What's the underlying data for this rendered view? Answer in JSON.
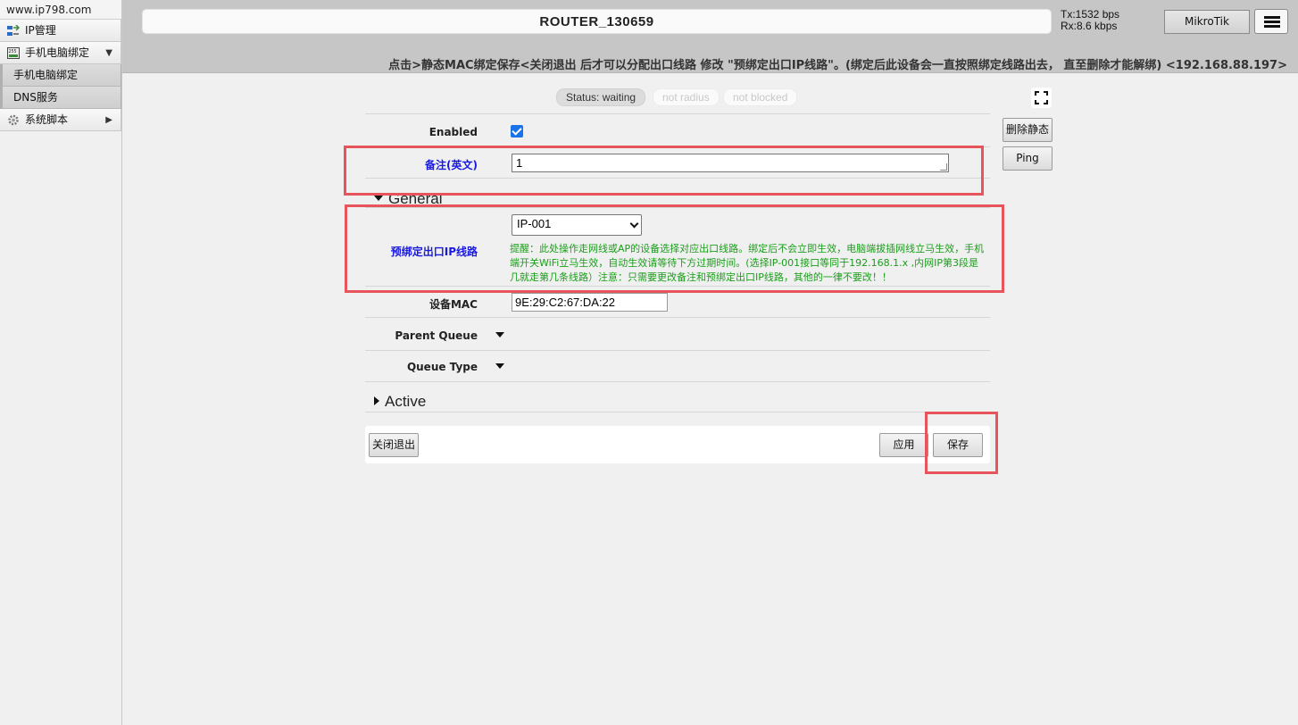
{
  "colors": {
    "highlight": "#e8545c",
    "label_blue": "#1a1adf",
    "hint_green": "#1a9e1a",
    "checkbox": "#1a73e8"
  },
  "sidebar": {
    "site": "www.ip798.com",
    "items": [
      {
        "label": "IP管理",
        "icon": "ip-management-icon"
      },
      {
        "label": "手机电脑绑定",
        "icon": "binding-icon",
        "arrow": "▼"
      },
      {
        "label": "系统脚本",
        "icon": "script-icon",
        "arrow": "▶"
      }
    ],
    "subitems": [
      {
        "label": "手机电脑绑定"
      },
      {
        "label": "DNS服务"
      }
    ]
  },
  "header": {
    "router_name": "ROUTER_130659",
    "tx": "Tx:1532 bps",
    "rx": "Rx:8.6 kbps",
    "brand_button": "MikroTik",
    "notice": "点击>静态MAC绑定保存<关闭退出 后才可以分配出口线路 修改 \"预绑定出口IP线路\"。(绑定后此设备会一直按照绑定线路出去， 直至删除才能解绑) <192.168.88.197>"
  },
  "status": {
    "status": "Status: waiting",
    "radius": "not radius",
    "blocked": "not blocked"
  },
  "side_buttons": {
    "delete_static": "删除静态",
    "ping": "Ping"
  },
  "form": {
    "enabled_label": "Enabled",
    "enabled": true,
    "note_label": "备注(英文)",
    "note_value": "1",
    "general_section": "General",
    "exit_ip_label": "预绑定出口IP线路",
    "exit_ip_value": "IP-001",
    "hint_line1": "提醒：此处操作走网线或AP的设备选择对应出口线路。绑定后不会立即生效，电脑端拔插网线立马生效，手机",
    "hint_line2": "端开关WiFi立马生效，自动生效请等待下方过期时间。(选择IP-001接口等同于192.168.1.x ,内网IP第3段是",
    "hint_line3": "几就走第几条线路）注意：只需要更改备注和预绑定出口IP线路，其他的一律不要改！！",
    "mac_label": "设备MAC",
    "mac_value": "9E:29:C2:67:DA:22",
    "parent_queue_label": "Parent Queue",
    "queue_type_label": "Queue Type",
    "active_section": "Active"
  },
  "bottom": {
    "close_exit": "关闭退出",
    "apply": "应用",
    "save": "保存"
  }
}
